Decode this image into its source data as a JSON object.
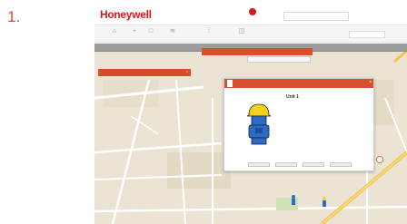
{
  "step": {
    "number": "1."
  },
  "header": {
    "logo": "Honeywell",
    "search_placeholder": "",
    "user_label": "",
    "help_label": ""
  },
  "toolbar": {
    "tools": [
      {
        "label": "",
        "icon": "home-icon",
        "active": true
      },
      {
        "label": "",
        "icon": "plus-icon",
        "active": false
      },
      {
        "label": "",
        "icon": "window-icon",
        "active": false
      },
      {
        "label": "",
        "icon": "signal-icon",
        "active": false
      },
      {
        "label": "",
        "icon": "grid-icon",
        "active": false
      },
      {
        "label": "",
        "icon": "layers-icon",
        "active": false
      }
    ],
    "select_value": ""
  },
  "panels": {
    "subbar_label": "",
    "popup_title": "",
    "map_controls_text": "",
    "left_panel_title": ""
  },
  "detail": {
    "tabs": [
      "",
      "",
      "",
      ""
    ],
    "unit_title": "Unit 1",
    "subtitles": [
      "",
      "",
      ""
    ],
    "rows": [
      {
        "label": "",
        "value": ""
      },
      {
        "label": "",
        "value": ""
      },
      {
        "label": "",
        "value": ""
      },
      {
        "label": "",
        "value": ""
      },
      {
        "label": "",
        "value": ""
      },
      {
        "label": "",
        "value": ""
      }
    ],
    "actions": [
      "",
      "",
      "",
      ""
    ]
  },
  "colors": {
    "brand_red": "#d71920",
    "accent_orange": "#d9502f",
    "map_bg": "#ebe3d4",
    "avatar_helmet": "#f2d11b",
    "avatar_body": "#2a6ac8"
  }
}
